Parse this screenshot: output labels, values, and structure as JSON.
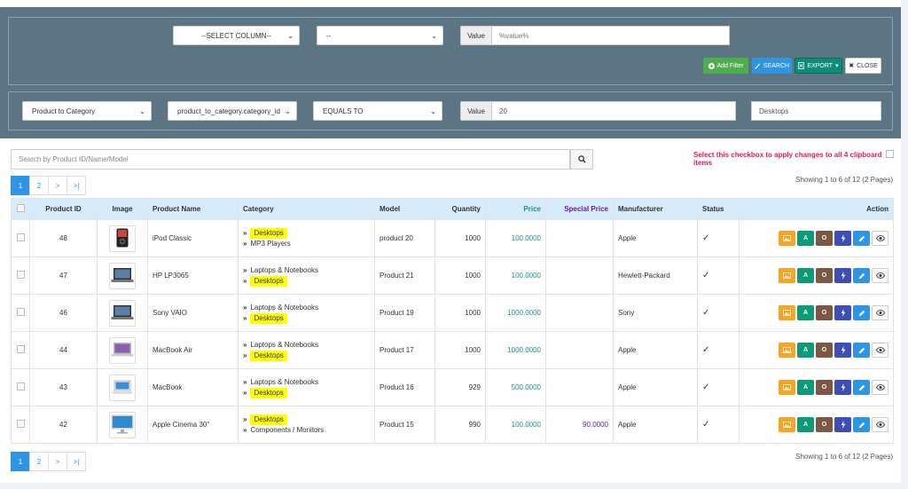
{
  "filter_row1": {
    "column_select": "--SELECT COLUMN--",
    "operator_select": "--",
    "value_addon": "Value",
    "value_placeholder": "%value%"
  },
  "buttons": {
    "add_filter": "Add Filter",
    "search": "SEARCH",
    "export": "EXPORT",
    "close": "CLOSE"
  },
  "filter_row2": {
    "table_select": "Product to Category",
    "column_select": "product_to_category.category_id",
    "operator_select": "EQUALS TO",
    "value_addon": "Value",
    "value": "20",
    "name_value": "Desktops"
  },
  "search": {
    "placeholder": "Search by Product ID/Name/Model"
  },
  "clipboard_note": "Select this checkbox to apply changes to all 4 clipboard items",
  "pagination": {
    "pages": [
      "1",
      "2",
      ">",
      ">|"
    ],
    "active": "1",
    "showing": "Showing 1 to 6 of 12 (2 Pages)"
  },
  "table": {
    "headers": {
      "product_id": "Product ID",
      "image": "Image",
      "product_name": "Product Name",
      "category": "Category",
      "model": "Model",
      "quantity": "Quantity",
      "price": "Price",
      "special_price": "Special Price",
      "manufacturer": "Manufacturer",
      "status": "Status",
      "action": "Action"
    },
    "rows": [
      {
        "id": "48",
        "name": "iPod Classic",
        "cat1": "Desktops",
        "cat1_hl": true,
        "cat2": "MP3 Players",
        "cat2_hl": false,
        "model": "product 20",
        "qty": "1000",
        "price": "100.0000",
        "special": "",
        "manufacturer": "Apple",
        "icon": "ipod"
      },
      {
        "id": "47",
        "name": "HP LP3065",
        "cat1": "Laptops & Notebooks",
        "cat1_hl": false,
        "cat2": "Desktops",
        "cat2_hl": true,
        "model": "Product 21",
        "qty": "1000",
        "price": "100.0000",
        "special": "",
        "manufacturer": "Hewlett-Packard",
        "icon": "laptop"
      },
      {
        "id": "46",
        "name": "Sony VAIO",
        "cat1": "Laptops & Notebooks",
        "cat1_hl": false,
        "cat2": "Desktops",
        "cat2_hl": true,
        "model": "Product 19",
        "qty": "1000",
        "price": "1000.0000",
        "special": "",
        "manufacturer": "Sony",
        "icon": "laptop"
      },
      {
        "id": "44",
        "name": "MacBook Air",
        "cat1": "Laptops & Notebooks",
        "cat1_hl": false,
        "cat2": "Desktops",
        "cat2_hl": true,
        "model": "Product 17",
        "qty": "1000",
        "price": "1000.0000",
        "special": "",
        "manufacturer": "Apple",
        "icon": "macbook"
      },
      {
        "id": "43",
        "name": "MacBook",
        "cat1": "Laptops & Notebooks",
        "cat1_hl": false,
        "cat2": "Desktops",
        "cat2_hl": true,
        "model": "Product 16",
        "qty": "929",
        "price": "500.0000",
        "special": "",
        "manufacturer": "Apple",
        "icon": "macbook-white"
      },
      {
        "id": "42",
        "name": "Apple Cinema 30\"",
        "cat1": "Desktops",
        "cat1_hl": true,
        "cat2": "Components / Monitors",
        "cat2_hl": false,
        "model": "Product 15",
        "qty": "990",
        "price": "100.0000",
        "special": "90.0000",
        "manufacturer": "Apple",
        "icon": "monitor"
      }
    ],
    "action_labels": {
      "a": "A",
      "o": "O"
    }
  },
  "colors": {
    "panel": "#5b7584",
    "header_row": "#d6ebfb",
    "highlight": "#ffff00",
    "accent": "#2d95e3"
  }
}
